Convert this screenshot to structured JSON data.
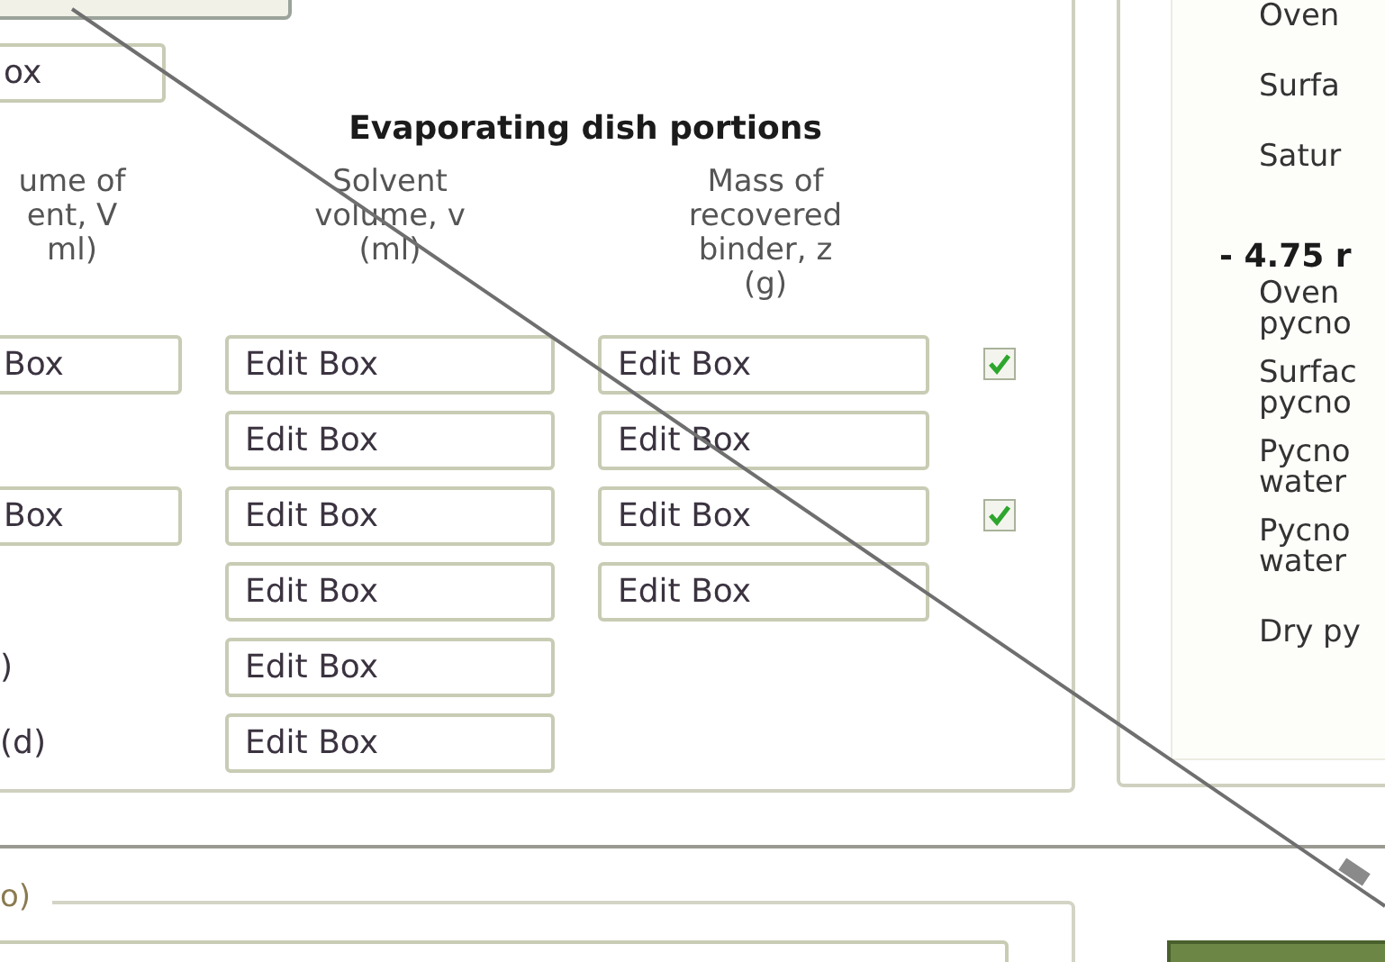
{
  "top_field": {
    "value": "ox"
  },
  "evaporating": {
    "title": "Evaporating dish portions",
    "columns": [
      {
        "lines": [
          "ume of",
          "ent, V",
          "ml)"
        ]
      },
      {
        "lines": [
          "Solvent",
          "volume, v",
          "(ml)"
        ]
      },
      {
        "lines": [
          "Mass of",
          "recovered",
          "binder, z",
          "(g)"
        ]
      }
    ],
    "rows": [
      {
        "left": {
          "kind": "field",
          "text": "Box"
        },
        "solvent": "Edit Box",
        "mass": "Edit Box",
        "checkbox": {
          "checked": true
        }
      },
      {
        "solvent": "Edit Box",
        "mass": "Edit Box"
      },
      {
        "left": {
          "kind": "field",
          "text": "Box"
        },
        "solvent": "Edit Box",
        "mass": "Edit Box",
        "checkbox": {
          "checked": true
        }
      },
      {
        "solvent": "Edit Box",
        "mass": "Edit Box"
      },
      {
        "left": {
          "kind": "label",
          "text": ")"
        },
        "solvent": "Edit Box"
      },
      {
        "left": {
          "kind": "label",
          "text": "(d)"
        },
        "solvent": "Edit Box"
      }
    ]
  },
  "right_panel": {
    "items": [
      {
        "kind": "label",
        "lines": [
          "Oven"
        ]
      },
      {
        "kind": "label",
        "lines": [
          "Surfa"
        ]
      },
      {
        "kind": "label",
        "lines": [
          "Satur"
        ]
      },
      {
        "kind": "heading",
        "lines": [
          "- 4.75 r"
        ]
      },
      {
        "kind": "label",
        "lines": [
          "Oven",
          "pycno"
        ]
      },
      {
        "kind": "label",
        "lines": [
          "Surfac",
          "pycno"
        ]
      },
      {
        "kind": "label",
        "lines": [
          "Pycno",
          "water"
        ]
      },
      {
        "kind": "label",
        "lines": [
          "Pycno",
          "water"
        ]
      },
      {
        "kind": "label",
        "lines": [
          "Dry py"
        ]
      }
    ]
  },
  "bottom_group": {
    "legend": "o)"
  }
}
